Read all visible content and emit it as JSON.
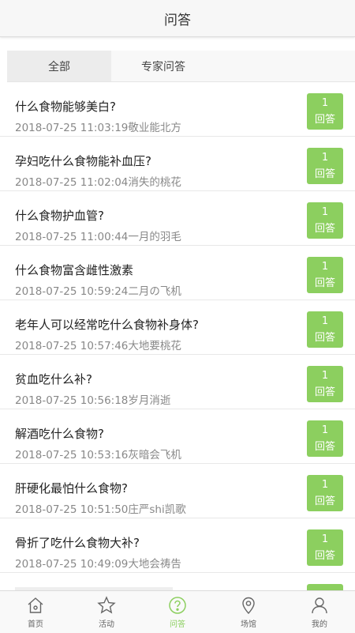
{
  "header": {
    "title": "问答"
  },
  "tabs": [
    {
      "label": "全部",
      "active": true
    },
    {
      "label": "专家问答",
      "active": false
    }
  ],
  "questions": [
    {
      "title": "什么食物能够美白?",
      "meta": "2018-07-25 11:03:19敬业能北方",
      "count": "1",
      "action": "回答"
    },
    {
      "title": "孕妇吃什么食物能补血压?",
      "meta": "2018-07-25 11:02:04消失的桃花",
      "count": "1",
      "action": "回答"
    },
    {
      "title": "什么食物护血管?",
      "meta": "2018-07-25 11:00:44一月的羽毛",
      "count": "1",
      "action": "回答"
    },
    {
      "title": "什么食物富含雌性激素",
      "meta": "2018-07-25 10:59:24二月の飞机",
      "count": "1",
      "action": "回答"
    },
    {
      "title": "老年人可以经常吃什么食物补身体?",
      "meta": "2018-07-25 10:57:46大地要桃花",
      "count": "1",
      "action": "回答"
    },
    {
      "title": "贫血吃什么补?",
      "meta": "2018-07-25 10:56:18岁月消逝",
      "count": "1",
      "action": "回答"
    },
    {
      "title": "解酒吃什么食物?",
      "meta": "2018-07-25 10:53:16灰暗会飞机",
      "count": "1",
      "action": "回答"
    },
    {
      "title": "肝硬化最怕什么食物?",
      "meta": "2018-07-25 10:51:50庄严shi凯歌",
      "count": "1",
      "action": "回答"
    },
    {
      "title": "骨折了吃什么食物大补?",
      "meta": "2018-07-25 10:49:09大地会祷告",
      "count": "1",
      "action": "回答"
    }
  ],
  "tabbar": [
    {
      "label": "首页",
      "icon": "home-icon",
      "active": false
    },
    {
      "label": "活动",
      "icon": "star-icon",
      "active": false
    },
    {
      "label": "问答",
      "icon": "question-icon",
      "active": true
    },
    {
      "label": "场馆",
      "icon": "location-icon",
      "active": false
    },
    {
      "label": "我的",
      "icon": "user-icon",
      "active": false
    }
  ],
  "colors": {
    "accent": "#8ccf5f",
    "header_bg": "#f7f7f7"
  }
}
